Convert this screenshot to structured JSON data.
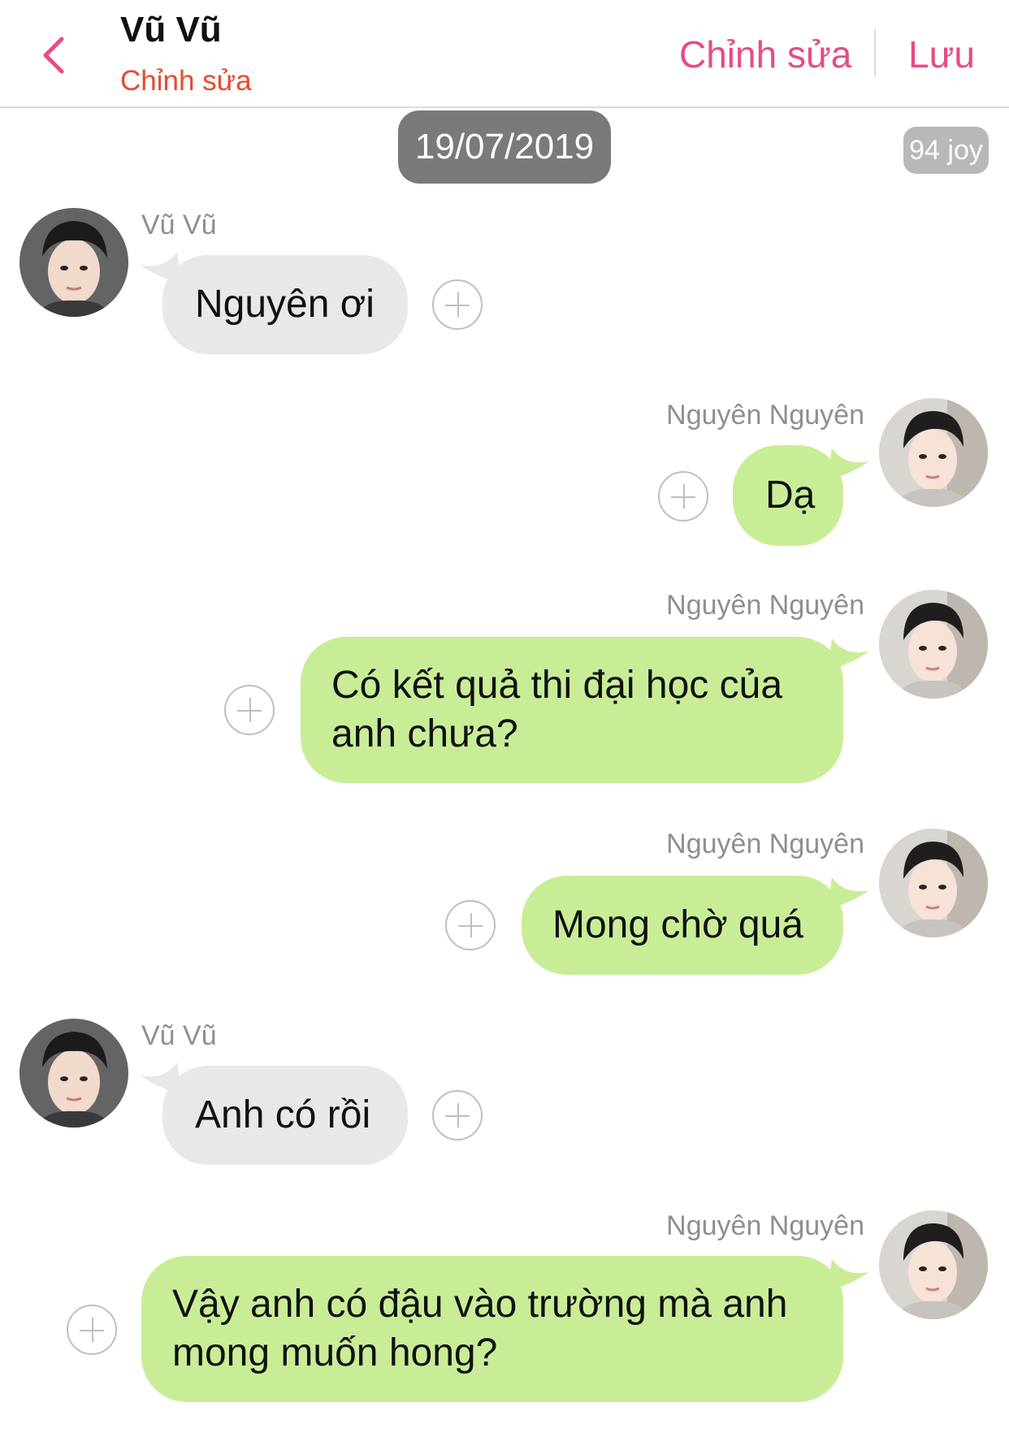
{
  "header": {
    "title": "Vũ Vũ",
    "subtitle": "Chỉnh sửa",
    "edit_label": "Chỉnh sửa",
    "save_label": "Lưu"
  },
  "date": "19/07/2019",
  "joy_badge": "94 joy",
  "colors": {
    "accent": "#e64c86",
    "subtitle": "#e8492e",
    "incoming_bubble": "#e6e8ea",
    "outgoing_bubble": "#c9ed97",
    "date_chip": "#7a7a7a"
  },
  "messages": [
    {
      "sender": "Vũ Vũ",
      "side": "left",
      "text": "Nguyên ơi"
    },
    {
      "sender": "Nguyên Nguyên",
      "side": "right",
      "text": "Dạ"
    },
    {
      "sender": "Nguyên Nguyên",
      "side": "right",
      "text": "Có kết quả thi đại học của anh chưa?"
    },
    {
      "sender": "Nguyên Nguyên",
      "side": "right",
      "text": "Mong chờ quá"
    },
    {
      "sender": "Vũ Vũ",
      "side": "left",
      "text": "Anh có rồi"
    },
    {
      "sender": "Nguyên Nguyên",
      "side": "right",
      "text": "Vậy anh có đậu vào trường mà anh mong muốn hong?"
    }
  ]
}
